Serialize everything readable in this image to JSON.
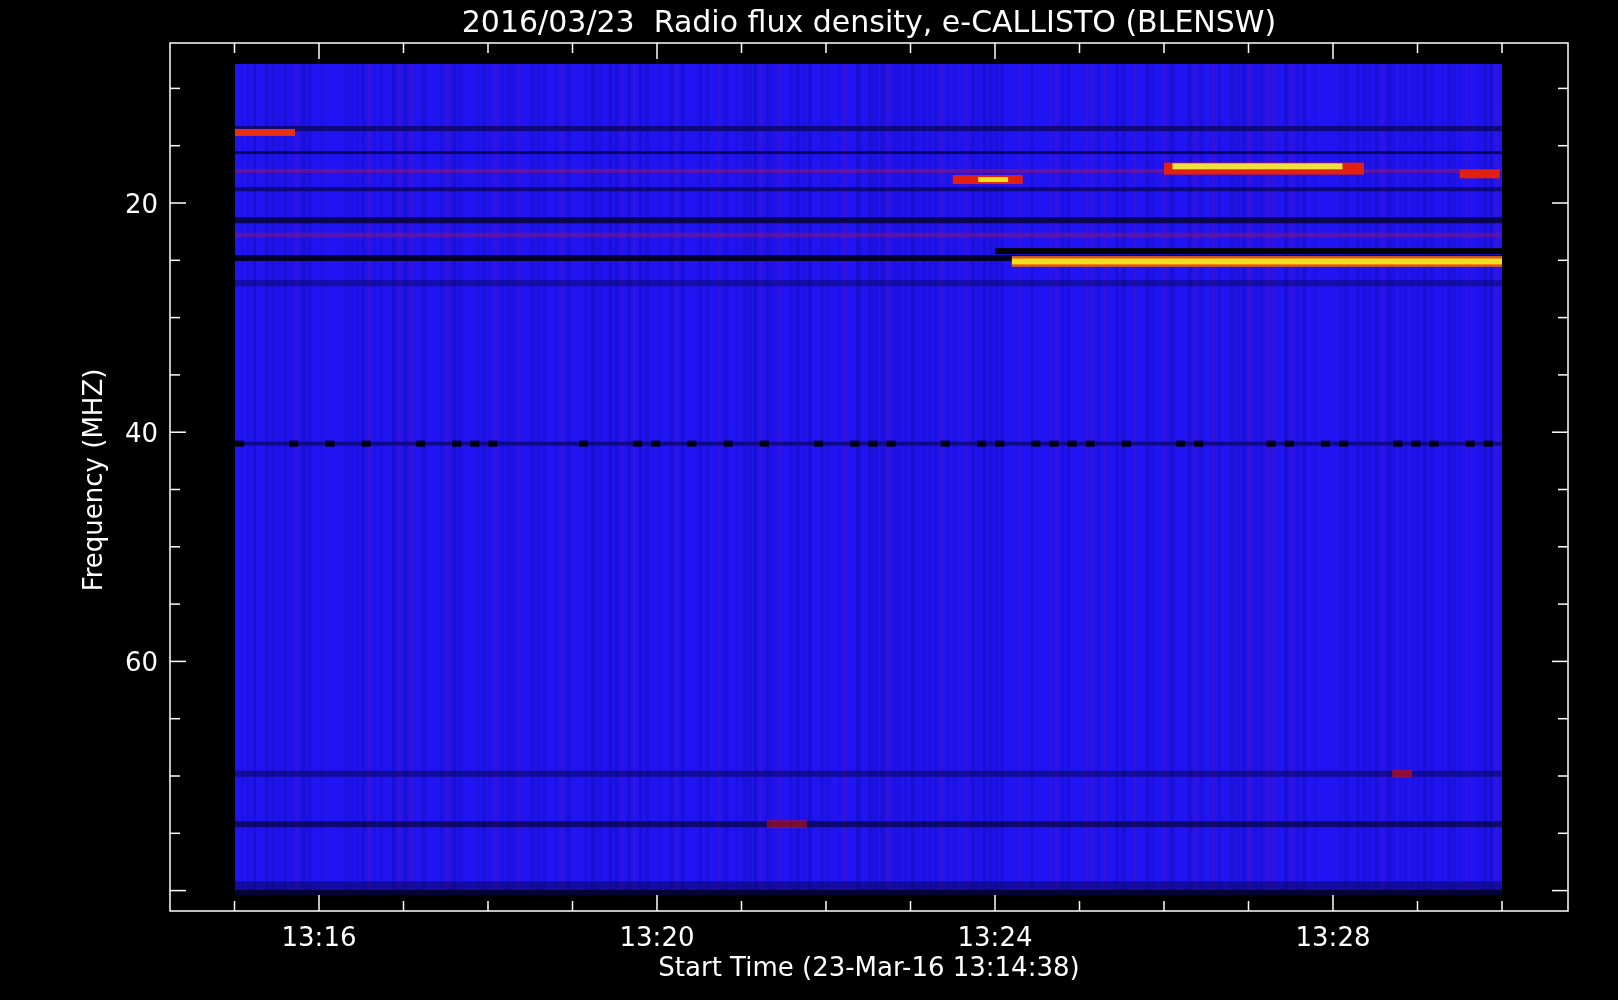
{
  "plot": {
    "title": "2016/03/23  Radio flux density, e-CALLISTO (BLENSW)",
    "ylabel": "Frequency (MHZ)",
    "xlabel": "Start Time (23-Mar-16 13:14:38)",
    "y_tick_labels": [
      "20",
      "40",
      "60"
    ],
    "x_tick_labels": [
      "13:16",
      "13:20",
      "13:24",
      "13:28"
    ]
  }
}
